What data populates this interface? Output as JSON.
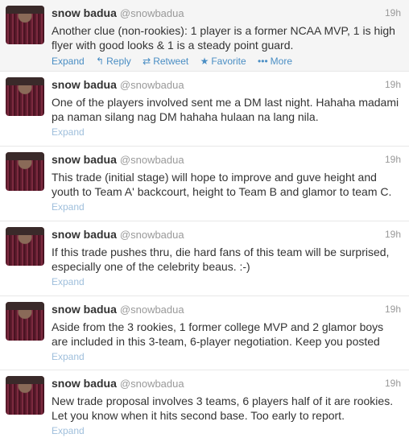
{
  "tweets": [
    {
      "fullname": "snow badua",
      "username": "@snowbadua",
      "time": "19h",
      "text": "Another clue (non-rookies): 1 player is a former NCAA MVP, 1 is high flyer with good looks & 1 is a steady point guard.",
      "expanded": true,
      "actions": {
        "expand": "Expand",
        "reply": "Reply",
        "retweet": "Retweet",
        "favorite": "Favorite",
        "more": "More",
        "reply_icon": "reply-arrow",
        "retweet_icon": "retweet-arrows",
        "favorite_icon": "star",
        "more_icon": "three-dots"
      }
    },
    {
      "fullname": "snow badua",
      "username": "@snowbadua",
      "time": "19h",
      "text": "One of the players involved sent me a DM last night. Hahaha madami pa naman silang nag DM hahaha hulaan na lang nila.",
      "expand": "Expand"
    },
    {
      "fullname": "snow badua",
      "username": "@snowbadua",
      "time": "19h",
      "text": "This trade (initial stage) will hope to improve and guve height and youth to Team A' backcourt, height to Team B and glamor to team C.",
      "expand": "Expand"
    },
    {
      "fullname": "snow badua",
      "username": "@snowbadua",
      "time": "19h",
      "text": "If this trade pushes thru, die hard fans of this team will be surprised, especially one of the celebrity beaus. :-)",
      "expand": "Expand"
    },
    {
      "fullname": "snow badua",
      "username": "@snowbadua",
      "time": "19h",
      "text": "Aside from the 3 rookies, 1 former college MVP and 2 glamor boys are included in this 3-team, 6-player negotiation. Keep you posted",
      "expand": "Expand"
    },
    {
      "fullname": "snow badua",
      "username": "@snowbadua",
      "time": "19h",
      "text": "New trade proposal involves 3 teams, 6 players half of it are rookies. Let you know when it hits second base. Too early to report.",
      "expand": "Expand"
    }
  ],
  "colors": {
    "link": "#4a8ec4",
    "muted": "#999999",
    "expanded_bg": "#f5f5f5"
  }
}
